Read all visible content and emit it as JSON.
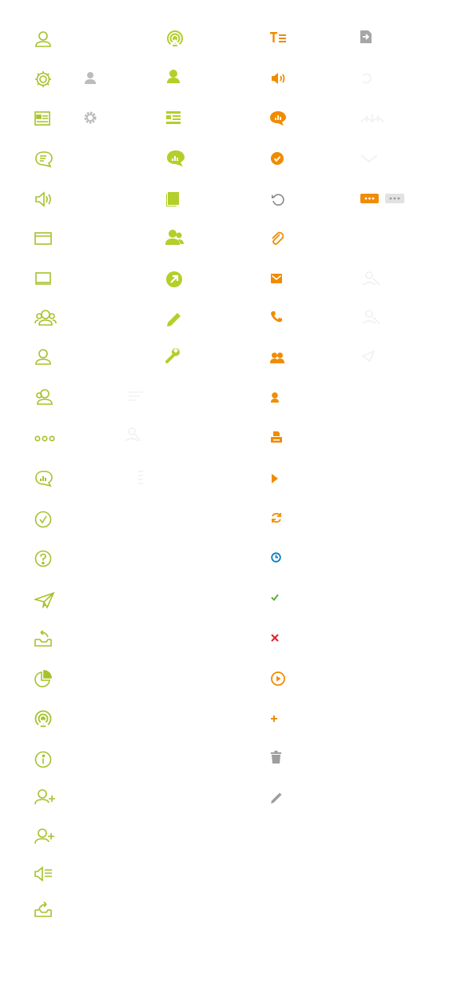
{
  "sprite": {
    "palette": {
      "olive": "#a5c22b",
      "lime": "#b3cf2a",
      "orange": "#f08c00",
      "gray": "#9e9e9e",
      "blue": "#0a7ec2",
      "green": "#5bae3a",
      "red": "#e0222c",
      "faint": "#eeeeee"
    },
    "columns": [
      {
        "style": "olive-outline",
        "icons": [
          "user-icon",
          "gear-icon",
          "list-layout-icon",
          "chat-text-icon",
          "speaker-icon",
          "window-icon",
          "monitor-icon",
          "group-icon",
          "user-icon",
          "user-add-icon",
          "ellipsis-icon",
          "chat-chart-icon",
          "check-circle-icon",
          "help-icon",
          "paper-plane-icon",
          "inbox-return-icon",
          "pie-chart-icon",
          "broadcast-icon",
          "info-icon",
          "user-plus-icon",
          "user-plus-icon",
          "speaker-list-icon",
          "share-icon"
        ]
      },
      {
        "style": "lime-solid",
        "icons": [
          "broadcast-icon",
          "user-icon",
          "list-layout-icon",
          "chat-chart-icon",
          "book-icon",
          "group-icon",
          "external-link-icon",
          "pencil-icon",
          "wrench-icon"
        ]
      },
      {
        "style": "orange-solid",
        "icons": [
          "text-size-icon",
          "volume-icon",
          "chat-chart-icon",
          "check-circle-icon",
          "refresh-icon",
          "paperclip-icon",
          "mail-icon",
          "phone-icon",
          "group-icon",
          "user-icon",
          "printer-icon",
          "play-icon",
          "sync-icon",
          "clock-icon",
          "check-icon",
          "close-icon",
          "play-circle-icon",
          "plus-icon",
          "trash-icon",
          "pencil-icon"
        ]
      },
      {
        "style": "gray-ghost",
        "icons": [
          "import-icon",
          "more-orange-icon",
          "more-gray-icon"
        ]
      }
    ]
  }
}
